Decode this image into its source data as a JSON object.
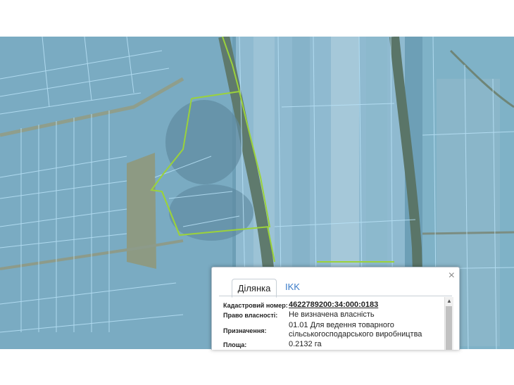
{
  "popup": {
    "close": "×",
    "tabs": [
      "Ділянка",
      "IKK"
    ],
    "rows": [
      {
        "label": "Кадастровий номер:",
        "value": "4622789200:34:000:0183"
      },
      {
        "label": "Право власності:",
        "value": "Не визначена власність"
      },
      {
        "label": "Призначення:",
        "value": "01.01 Для ведення товарного",
        "value2": "сільськогосподарського виробництва"
      },
      {
        "label": "Площа:",
        "value": "0.2132 га"
      }
    ],
    "scroll_up": "▲"
  },
  "colors": {
    "overlay": "#7fc3ee",
    "selection": "#9bd23b",
    "link": "#1a5fa8"
  }
}
